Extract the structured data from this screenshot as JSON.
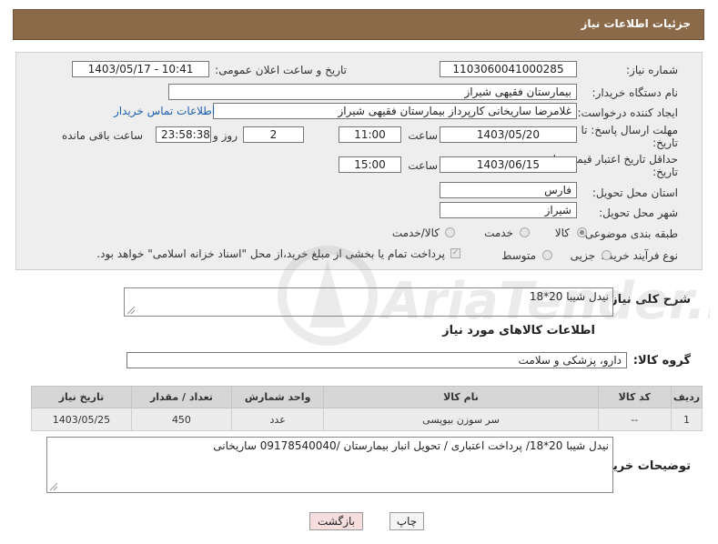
{
  "header": {
    "title": "جزئیات اطلاعات نیاز"
  },
  "form": {
    "need_number_label": "شماره نیاز:",
    "need_number": "1103060041000285",
    "announce_label": "تاریخ و ساعت اعلان عمومی:",
    "announce_value": "1403/05/17 - 10:41",
    "buyer_org_label": "نام دستگاه خریدار:",
    "buyer_org": "بیمارستان فقیهی شیراز",
    "creator_label": "ایجاد کننده درخواست:",
    "creator": "غلامرضا ساریخانی کارپرداز بیمارستان فقیهی شیراز",
    "contact_link": "اطلاعات تماس خریدار",
    "deadline_label_1": "مهلت ارسال پاسخ: تا",
    "deadline_label_2": "تاریخ:",
    "deadline_date": "1403/05/20",
    "time_label": "ساعت",
    "deadline_time": "11:00",
    "days_value": "2",
    "days_label": "روز و",
    "remaining_time": "23:58:38",
    "remaining_label": "ساعت باقی مانده",
    "validity_label_1": "حداقل تاریخ اعتبار قیمت: تا",
    "validity_label_2": "تاریخ:",
    "validity_date": "1403/06/15",
    "validity_time": "15:00",
    "province_label": "استان محل تحویل:",
    "province": "فارس",
    "city_label": "شهر محل تحویل:",
    "city": "شیراز",
    "category_label": "طبقه بندی موضوعی:",
    "category_options": [
      "کالا",
      "خدمت",
      "کالا/خدمت"
    ],
    "category_selected": "کالا",
    "process_label": "نوع فرآیند خرید :",
    "process_options": [
      "جزیی",
      "متوسط"
    ],
    "process_note": "پرداخت تمام یا بخشی از مبلغ خرید،از محل \"اسناد خزانه اسلامی\" خواهد بود."
  },
  "summary": {
    "label": "شرح کلی نیاز:",
    "value": "نیدل شیبا 20*18"
  },
  "goods": {
    "section_title": "اطلاعات کالاهای مورد نیاز",
    "group_label": "گروه کالا:",
    "group_value": "دارو، پزشکی و سلامت",
    "columns": [
      "ردیف",
      "کد کالا",
      "نام کالا",
      "واحد شمارش",
      "تعداد / مقدار",
      "تاریخ نیاز"
    ],
    "rows": [
      [
        "1",
        "--",
        "سر سوزن بیوپسی",
        "عدد",
        "450",
        "1403/05/25"
      ]
    ]
  },
  "buyer_notes": {
    "label": "توضیحات خریدار:",
    "value": "نیدل شیبا 20*18/ پرداخت اعتباری / تحویل انبار بیمارستان /09178540040 ساریخانی"
  },
  "buttons": {
    "print": "چاپ",
    "back": "بازگشت"
  },
  "watermark": {
    "text": "AriaTender.net"
  },
  "colors": {
    "title_bar": "#8b6a4a",
    "link": "#1c5fb0",
    "back_button": "#f7dede"
  }
}
